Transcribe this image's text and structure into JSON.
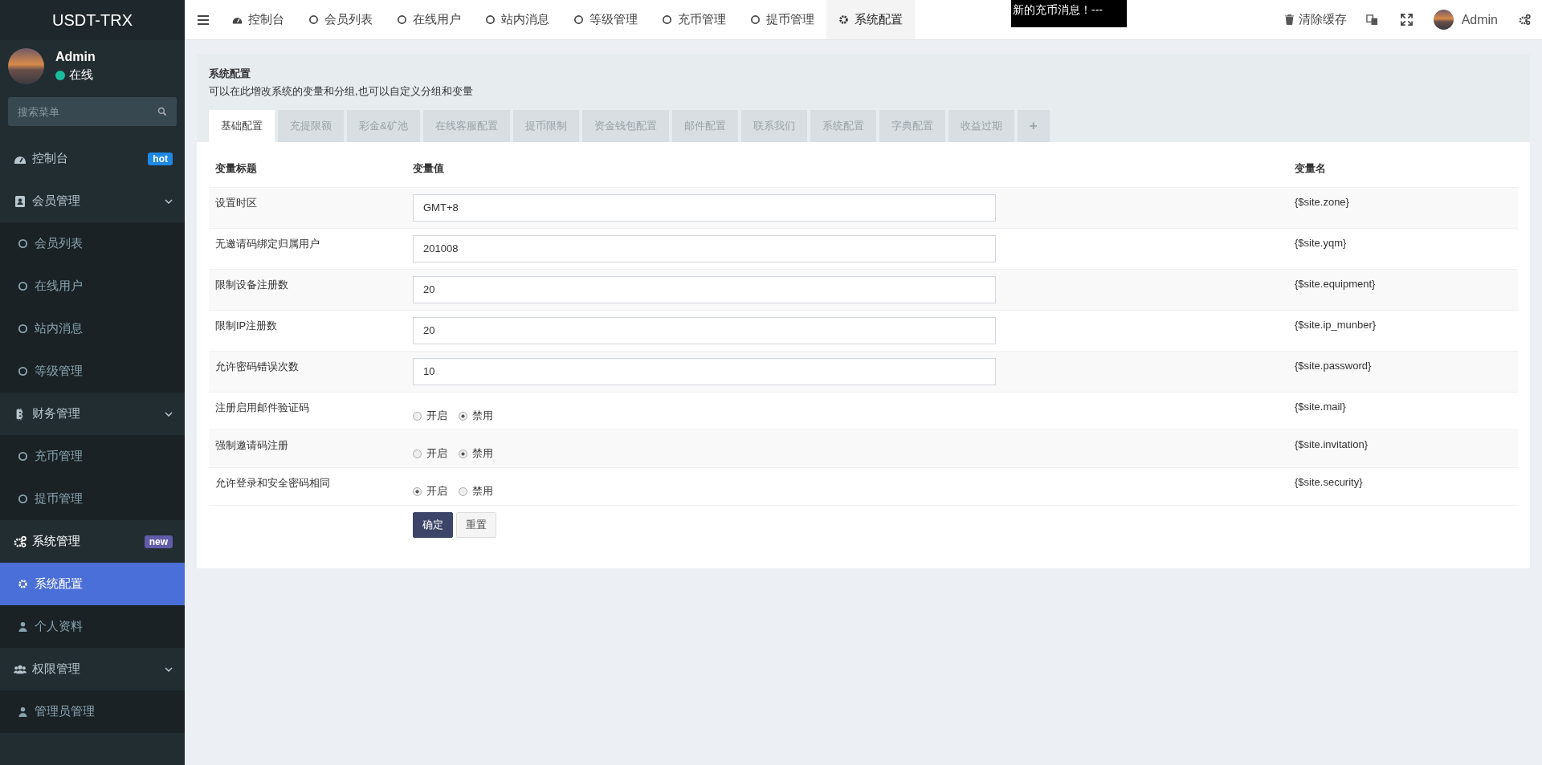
{
  "brand": {
    "title": "USDT-TRX"
  },
  "user_panel": {
    "name": "Admin",
    "status": "在线",
    "online": true
  },
  "sidebar": {
    "search": {
      "placeholder": "搜索菜单"
    },
    "items": [
      {
        "kind": "link",
        "label": "控制台",
        "badge": {
          "text": "hot",
          "color": "#1e88e5"
        },
        "selected": false
      },
      {
        "kind": "group",
        "label": "会员管理",
        "expanded": true,
        "children": [
          {
            "label": "会员列表",
            "selected": false
          },
          {
            "label": "在线用户",
            "selected": false
          },
          {
            "label": "站内消息",
            "selected": false
          },
          {
            "label": "等级管理",
            "selected": false
          }
        ]
      },
      {
        "kind": "group",
        "label": "财务管理",
        "expanded": true,
        "children": [
          {
            "label": "充币管理",
            "selected": false
          },
          {
            "label": "提币管理",
            "selected": false
          }
        ]
      },
      {
        "kind": "group",
        "label": "系统管理",
        "expanded": true,
        "badge": {
          "text": "new",
          "color": "#605ca8"
        },
        "children": [
          {
            "label": "系统配置",
            "selected": true
          },
          {
            "label": "个人资料",
            "selected": false
          }
        ]
      },
      {
        "kind": "group",
        "label": "权限管理",
        "expanded": true,
        "children": [
          {
            "label": "管理员管理",
            "selected": false
          }
        ]
      }
    ]
  },
  "topbar": {
    "tabs": [
      {
        "label": "控制台",
        "selected": false
      },
      {
        "label": "会员列表",
        "selected": false
      },
      {
        "label": "在线用户",
        "selected": false
      },
      {
        "label": "站内消息",
        "selected": false
      },
      {
        "label": "等级管理",
        "selected": false
      },
      {
        "label": "充币管理",
        "selected": false
      },
      {
        "label": "提币管理",
        "selected": false
      },
      {
        "label": "系统配置",
        "selected": true
      }
    ],
    "notice": "新的充币消息！---",
    "clear_cache": "清除缓存",
    "user": "Admin"
  },
  "page": {
    "title": "系统配置",
    "description": "可以在此增改系统的变量和分组,也可以自定义分组和变量",
    "tabs": [
      {
        "label": "基础配置",
        "selected": true
      },
      {
        "label": "充提限额",
        "selected": false
      },
      {
        "label": "彩金&矿池",
        "selected": false
      },
      {
        "label": "在线客服配置",
        "selected": false
      },
      {
        "label": "提币限制",
        "selected": false
      },
      {
        "label": "资金钱包配置",
        "selected": false
      },
      {
        "label": "邮件配置",
        "selected": false
      },
      {
        "label": "联系我们",
        "selected": false
      },
      {
        "label": "系统配置",
        "selected": false
      },
      {
        "label": "字典配置",
        "selected": false
      },
      {
        "label": "收益过期",
        "selected": false
      }
    ],
    "add_tab": "+",
    "table": {
      "columns": [
        "变量标题",
        "变量值",
        "变量名"
      ],
      "rows": [
        {
          "kind": "text",
          "title": "设置时区",
          "value": "GMT+8",
          "name": "{$site.zone}"
        },
        {
          "kind": "text",
          "title": "无邀请码绑定归属用户",
          "value": "201008",
          "name": "{$site.yqm}"
        },
        {
          "kind": "text",
          "title": "限制设备注册数",
          "value": "20",
          "name": "{$site.equipment}"
        },
        {
          "kind": "text",
          "title": "限制IP注册数",
          "value": "20",
          "name": "{$site.ip_munber}"
        },
        {
          "kind": "text",
          "title": "允许密码错误次数",
          "value": "10",
          "name": "{$site.password}"
        },
        {
          "kind": "radio",
          "title": "注册启用邮件验证码",
          "options": [
            {
              "label": "开启",
              "checked": false
            },
            {
              "label": "禁用",
              "checked": true
            }
          ],
          "name": "{$site.mail}"
        },
        {
          "kind": "radio",
          "title": "强制邀请码注册",
          "options": [
            {
              "label": "开启",
              "checked": false
            },
            {
              "label": "禁用",
              "checked": true
            }
          ],
          "name": "{$site.invitation}"
        },
        {
          "kind": "radio",
          "title": "允许登录和安全密码相同",
          "options": [
            {
              "label": "开启",
              "checked": true
            },
            {
              "label": "禁用",
              "checked": false
            }
          ],
          "name": "{$site.security}"
        }
      ]
    },
    "buttons": [
      {
        "kind": "primary",
        "label": "确定"
      },
      {
        "kind": "default",
        "label": "重置"
      }
    ]
  }
}
